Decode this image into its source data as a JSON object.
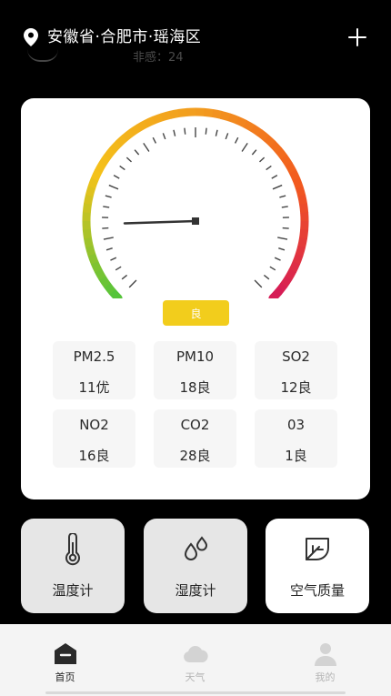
{
  "header": {
    "location": "安徽省·合肥市·瑶海区",
    "pin_icon": "location-pin-icon",
    "add_icon": "plus-icon",
    "ghost_text": "非感：24"
  },
  "gauge": {
    "level": 0.05,
    "badge_label": "良",
    "badge_color": "#f2cd1c",
    "gradient_colors": [
      "#55c43a",
      "#f4c21a",
      "#f29b1f",
      "#f2591e",
      "#d4185a"
    ]
  },
  "metrics": [
    {
      "name": "PM2.5",
      "value": "11优"
    },
    {
      "name": "PM10",
      "value": "18良"
    },
    {
      "name": "SO2",
      "value": "12良"
    },
    {
      "name": "NO2",
      "value": "16良"
    },
    {
      "name": "CO2",
      "value": "28良"
    },
    {
      "name": "03",
      "value": "1良"
    }
  ],
  "tools": [
    {
      "label": "温度计",
      "icon": "thermometer-icon"
    },
    {
      "label": "湿度计",
      "icon": "droplets-icon"
    },
    {
      "label": "空气质量",
      "icon": "leaf-icon"
    }
  ],
  "tabs": [
    {
      "label": "首页",
      "icon": "home-icon",
      "active": true
    },
    {
      "label": "天气",
      "icon": "cloud-icon",
      "active": false
    },
    {
      "label": "我的",
      "icon": "user-icon",
      "active": false
    }
  ]
}
